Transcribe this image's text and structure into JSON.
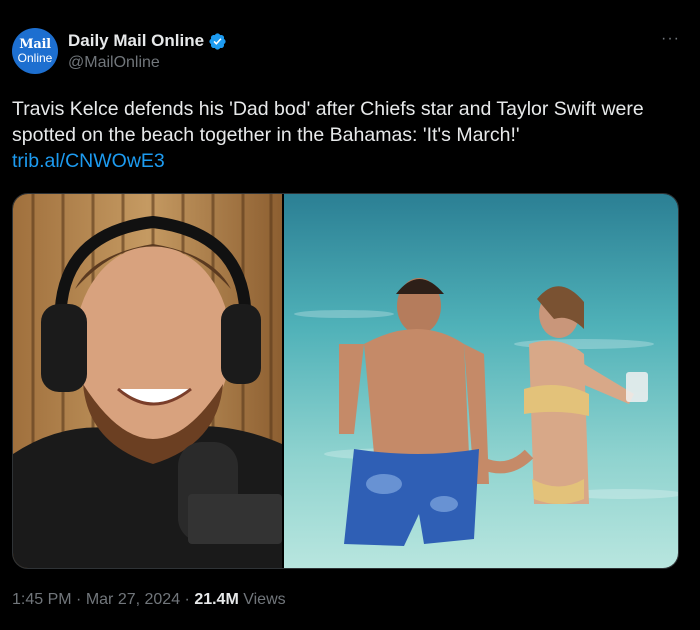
{
  "account": {
    "avatar_line1": "Mail",
    "avatar_line2": "Online",
    "display_name": "Daily Mail Online",
    "handle": "@MailOnline",
    "verified_color": "#1d9bf0"
  },
  "more_label": "···",
  "tweet": {
    "text": "Travis Kelce defends his 'Dad bod' after Chiefs star and Taylor Swift were spotted on the beach together in the Bahamas: 'It's March!'",
    "link": "trib.al/CNWOwE3"
  },
  "media": {
    "left_icon": "podcast-photo",
    "right_icon": "beach-photo"
  },
  "meta": {
    "time": "1:45 PM",
    "separator1": " · ",
    "date": "Mar 27, 2024",
    "separator2": " · ",
    "views_count": "21.4M",
    "views_label": " Views"
  }
}
